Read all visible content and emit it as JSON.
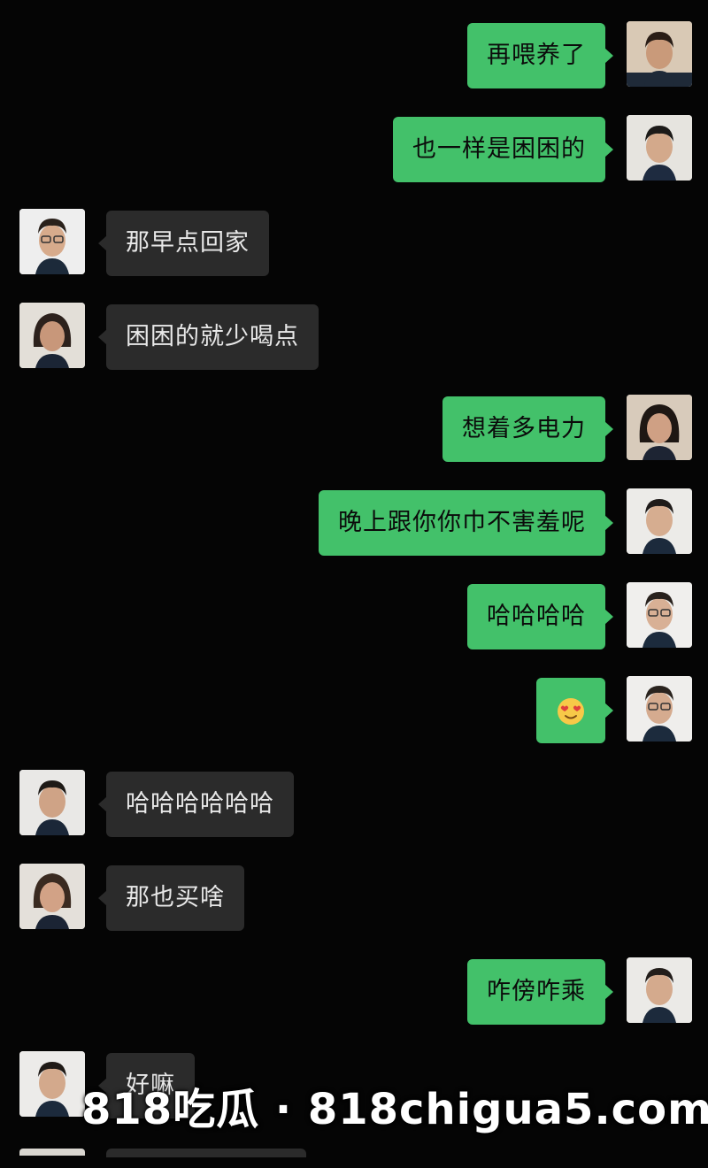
{
  "messages": [
    {
      "side": "out",
      "text": "再喂养了",
      "avatar": "avatar-man-1"
    },
    {
      "side": "out",
      "text": "也一样是困困的",
      "avatar": "avatar-man-2"
    },
    {
      "side": "in",
      "text": "那早点回家",
      "avatar": "avatar-man-glasses"
    },
    {
      "side": "in",
      "text": "困困的就少喝点",
      "avatar": "avatar-woman-1"
    },
    {
      "side": "out",
      "text": "想着多电力",
      "avatar": "avatar-woman-2"
    },
    {
      "side": "out",
      "text": "晚上跟你你巾不害羞呢",
      "avatar": "avatar-man-3"
    },
    {
      "side": "out",
      "text": "哈哈哈哈",
      "avatar": "avatar-man-glasses-2"
    },
    {
      "side": "out",
      "text": "",
      "emoji": "heart-eyes-emoji",
      "avatar": "avatar-man-glasses-3"
    },
    {
      "side": "in",
      "text": "哈哈哈哈哈哈",
      "avatar": "avatar-man-4"
    },
    {
      "side": "in",
      "text": "那也买啥",
      "avatar": "avatar-woman-3"
    },
    {
      "side": "out",
      "text": "咋傍咋乘",
      "avatar": "avatar-man-5"
    },
    {
      "side": "in",
      "text": "好嘛",
      "avatar": "avatar-man-6"
    }
  ],
  "watermark": "818吃瓜 · 818chigua5.com",
  "colors": {
    "background": "#050505",
    "outgoing_bubble": "#43c16a",
    "incoming_bubble": "#2b2b2b"
  }
}
